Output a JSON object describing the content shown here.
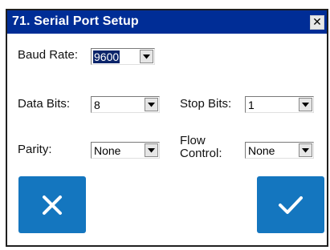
{
  "window": {
    "title": "71. Serial Port Setup",
    "close_glyph": "✕"
  },
  "fields": {
    "baud_rate": {
      "label": "Baud Rate:",
      "value": "9600"
    },
    "data_bits": {
      "label": "Data Bits:",
      "value": "8"
    },
    "stop_bits": {
      "label": "Stop Bits:",
      "value": "1"
    },
    "parity": {
      "label": "Parity:",
      "value": "None"
    },
    "flow_control": {
      "label_line1": "Flow",
      "label_line2": "Control:",
      "value": "None"
    }
  },
  "buttons": {
    "cancel": {
      "icon": "close-icon",
      "color": "#1476bf"
    },
    "confirm": {
      "icon": "checkmark-icon",
      "color": "#1476bf"
    }
  },
  "colors": {
    "titlebar": "#002d96",
    "selection": "#0a246a"
  }
}
